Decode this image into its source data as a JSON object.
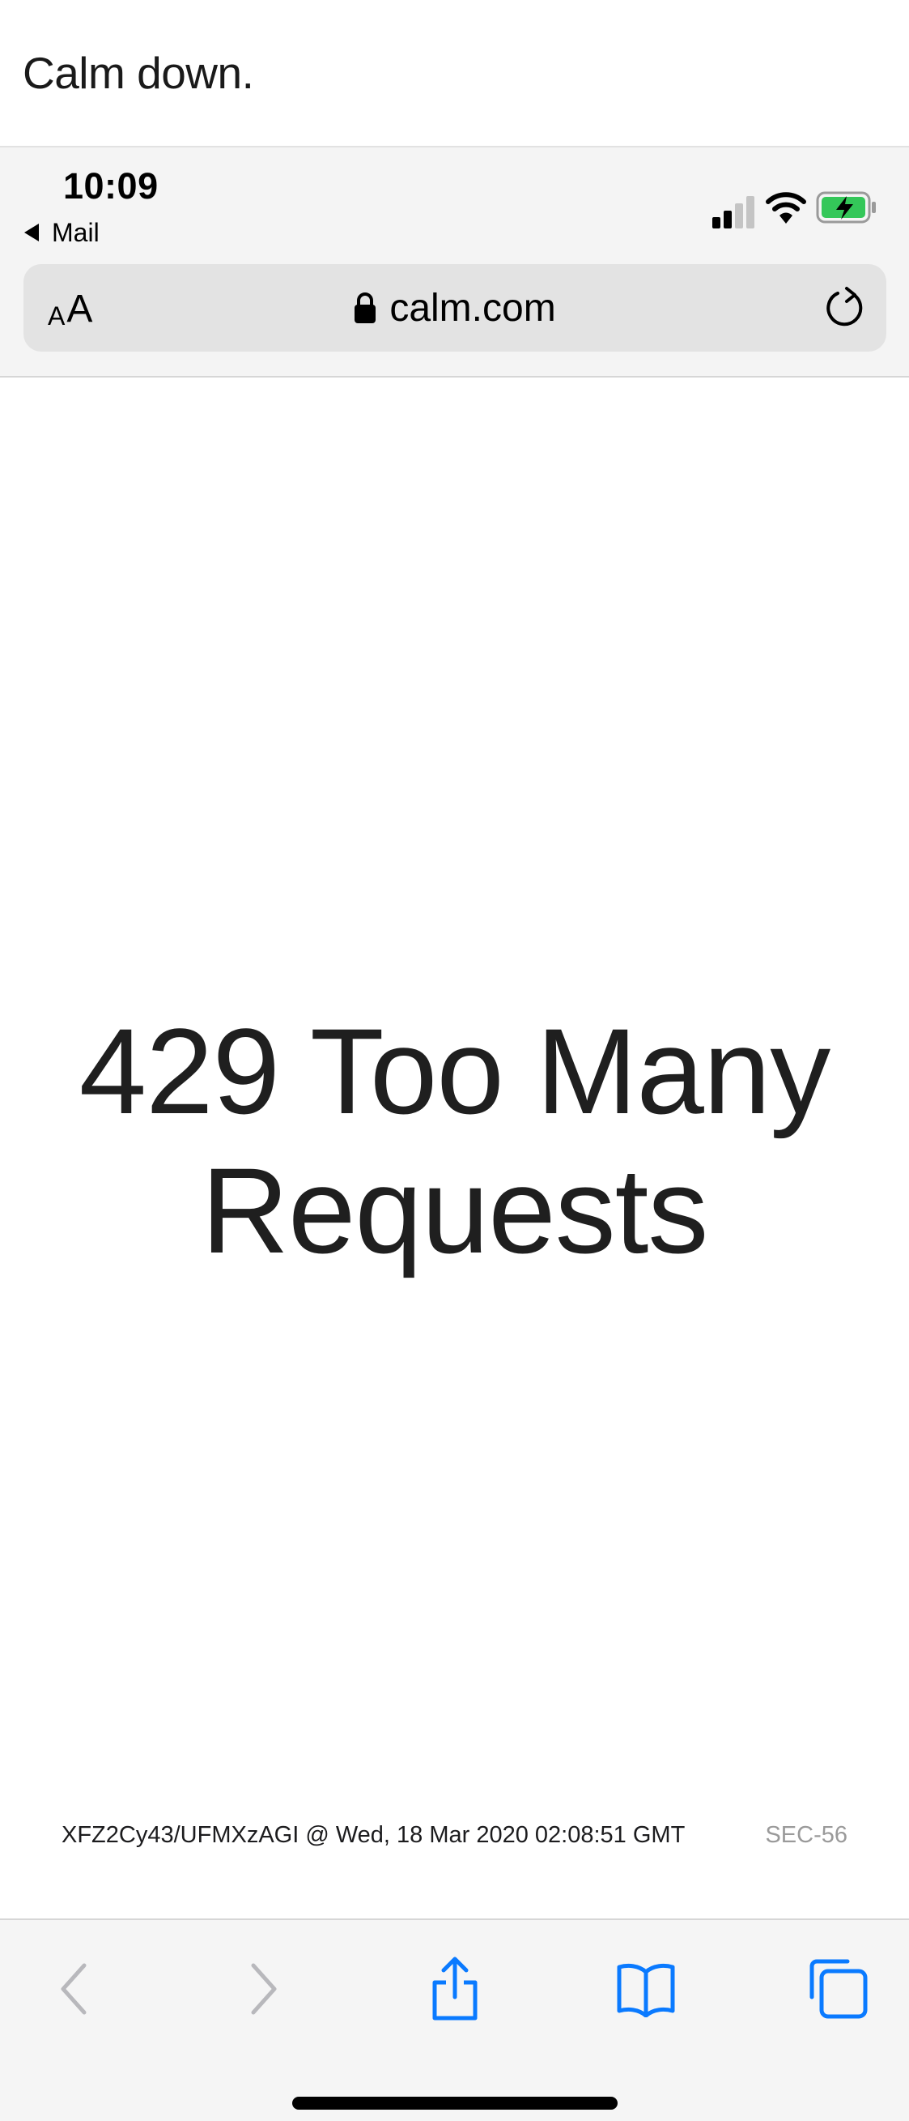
{
  "caption": {
    "text": "Calm down."
  },
  "status_bar": {
    "time": "10:09",
    "back_app_label": "Mail",
    "signal_bars_filled": 2,
    "signal_bars_total": 4,
    "battery_color": "#34c759"
  },
  "address_bar": {
    "text_size_label_small": "A",
    "text_size_label_large": "A",
    "domain": "calm.com"
  },
  "page": {
    "headline": "429 Too Many Requests",
    "request_info": "XFZ2Cy43/UFMXzAGI @ Wed, 18 Mar 2020 02:08:51 GMT",
    "error_code": "SEC-56"
  },
  "toolbar": {
    "buttons": [
      "back",
      "forward",
      "share",
      "bookmarks",
      "tabs"
    ],
    "accent_color": "#0a7aff",
    "disabled_color": "#b8b8bc"
  }
}
